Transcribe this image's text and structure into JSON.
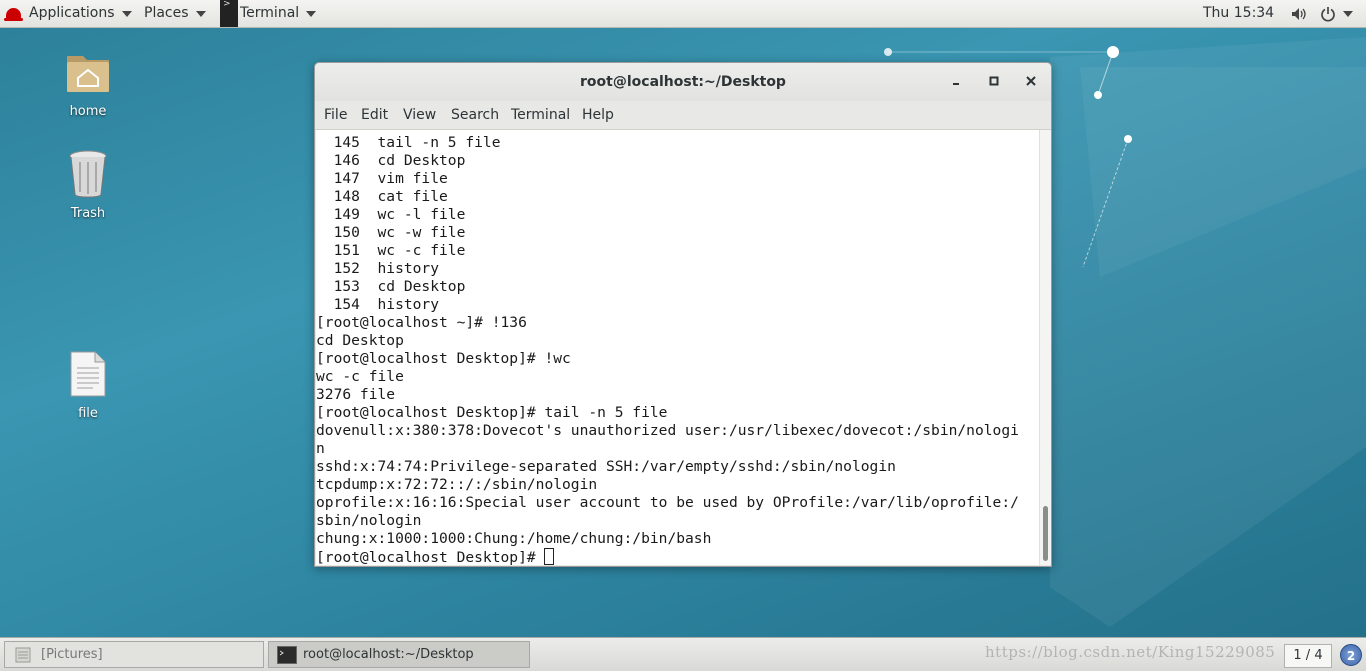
{
  "topbar": {
    "applications": "Applications",
    "places": "Places",
    "active_app": "Terminal",
    "clock": "Thu 15:34"
  },
  "desktop": {
    "icons": [
      {
        "label": "home",
        "icon": "folder-home-icon"
      },
      {
        "label": "Trash",
        "icon": "trash-icon"
      },
      {
        "label": "file",
        "icon": "text-file-icon"
      }
    ]
  },
  "window": {
    "title": "root@localhost:~/Desktop",
    "menu": [
      "File",
      "Edit",
      "View",
      "Search",
      "Terminal",
      "Help"
    ],
    "lines": [
      "  145  tail -n 5 file",
      "  146  cd Desktop",
      "  147  vim file",
      "  148  cat file",
      "  149  wc -l file",
      "  150  wc -w file",
      "  151  wc -c file",
      "  152  history",
      "  153  cd Desktop",
      "  154  history",
      "[root@localhost ~]# !136",
      "cd Desktop",
      "[root@localhost Desktop]# !wc",
      "wc -c file",
      "3276 file",
      "[root@localhost Desktop]# tail -n 5 file",
      "dovenull:x:380:378:Dovecot's unauthorized user:/usr/libexec/dovecot:/sbin/nologi",
      "n",
      "sshd:x:74:74:Privilege-separated SSH:/var/empty/sshd:/sbin/nologin",
      "tcpdump:x:72:72::/:/sbin/nologin",
      "oprofile:x:16:16:Special user account to be used by OProfile:/var/lib/oprofile:/",
      "sbin/nologin",
      "chung:x:1000:1000:Chung:/home/chung:/bin/bash"
    ],
    "prompt": "[root@localhost Desktop]# "
  },
  "taskbar": {
    "tasks": [
      {
        "label": "[Pictures]",
        "state": "minimized"
      },
      {
        "label": "root@localhost:~/Desktop",
        "state": "active"
      }
    ],
    "watermark": "https://blog.csdn.net/King15229085",
    "workspace": "1 / 4",
    "notifications": "2"
  },
  "colors": {
    "desktop_bg": "#2f87a3",
    "terminal_bg": "#ffffff",
    "terminal_fg": "#1a1a1a"
  }
}
